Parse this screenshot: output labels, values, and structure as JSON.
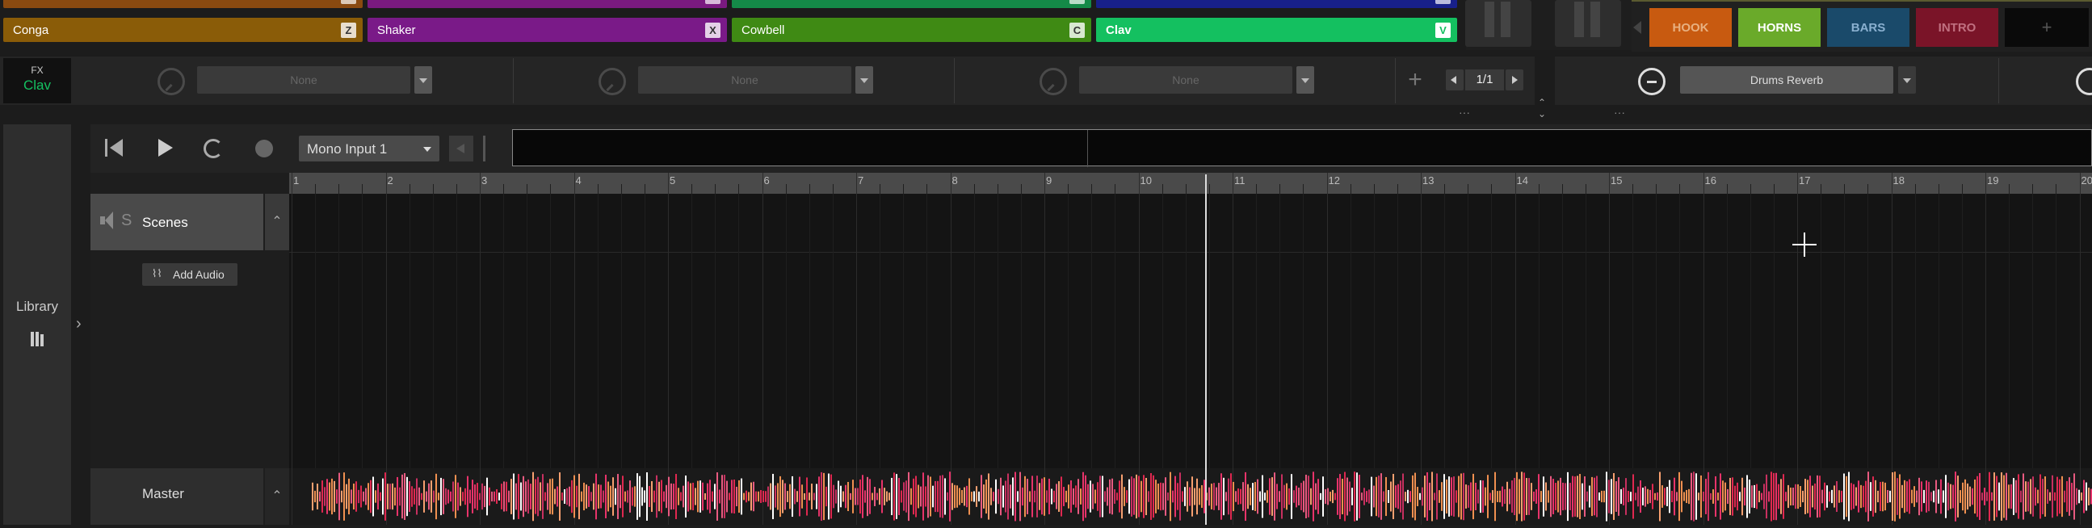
{
  "pads_top_row": [
    {
      "label": "",
      "color": "#8a4a10"
    },
    {
      "label": "",
      "color": "#7a1a80"
    },
    {
      "label": "",
      "color": "#148a48"
    },
    {
      "label": "",
      "color": "#18208a"
    }
  ],
  "pads": [
    {
      "label": "Conga",
      "key": "Z",
      "color": "#8a5c08"
    },
    {
      "label": "Shaker",
      "key": "X",
      "color": "#7a1a88"
    },
    {
      "label": "Cowbell",
      "key": "C",
      "color": "#3f8a14"
    },
    {
      "label": "Clav",
      "key": "V",
      "color": "#14c060"
    }
  ],
  "fx": {
    "label": "FX",
    "name": "Clav",
    "slots": [
      "None",
      "None",
      "None"
    ]
  },
  "paging": {
    "page": "1/1"
  },
  "send": {
    "name": "Drums Reverb"
  },
  "scenes": [
    {
      "label": "HOOK",
      "color": "#c85a10"
    },
    {
      "label": "HORNS",
      "color": "#6aaa2a"
    },
    {
      "label": "BARS",
      "color": "#1a4a6a"
    },
    {
      "label": "INTRO",
      "color": "#7a1428"
    },
    {
      "label": "+",
      "color": "#0a0a0a"
    }
  ],
  "library": {
    "label": "Library"
  },
  "transport": {
    "input": "Mono Input 1"
  },
  "ruler": [
    "1",
    "2",
    "3",
    "4",
    "5",
    "6",
    "7",
    "8",
    "9",
    "10",
    "11",
    "12",
    "13",
    "14",
    "15",
    "16",
    "17",
    "18",
    "19",
    "20"
  ],
  "tracks": {
    "scenes": {
      "mute": "",
      "solo": "S",
      "label": "Scenes"
    },
    "add_audio": "Add Audio",
    "master": "Master"
  },
  "colors": {
    "accent_green": "#14c060",
    "waveform_pink": "#e8336a",
    "waveform_orange": "#f09050"
  }
}
